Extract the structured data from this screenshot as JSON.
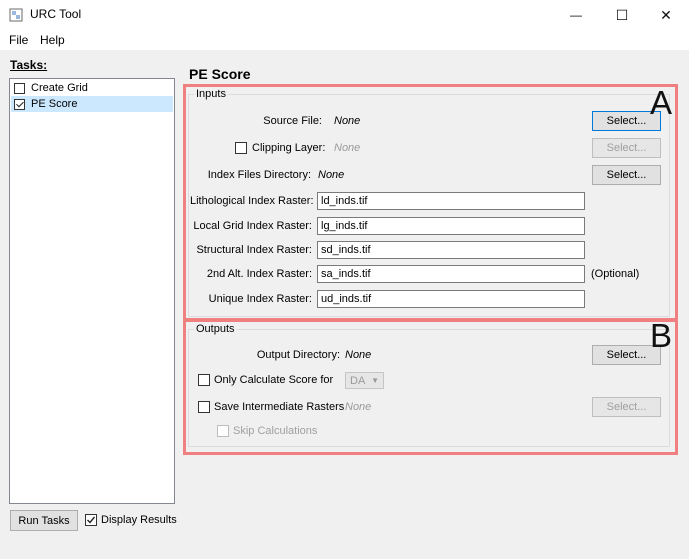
{
  "window": {
    "title": "URC Tool",
    "minimize_glyph": "—",
    "maximize_glyph": "☐",
    "close_glyph": "✕"
  },
  "menu": {
    "file": "File",
    "help": "Help"
  },
  "tasks": {
    "label": "Tasks:",
    "items": [
      {
        "label": "Create Grid",
        "checked": false,
        "selected": false
      },
      {
        "label": "PE Score",
        "checked": true,
        "selected": true
      }
    ],
    "run_button": "Run Tasks",
    "display_results": {
      "label": "Display Results",
      "checked": true
    }
  },
  "pe": {
    "title": "PE Score",
    "inputs": {
      "group_title": "Inputs",
      "source_file": {
        "label": "Source File:",
        "value": "None",
        "button": "Select..."
      },
      "clipping_layer": {
        "label": "Clipping Layer:",
        "value": "None",
        "button": "Select...",
        "checked": false
      },
      "index_dir": {
        "label": "Index Files Directory:",
        "value": "None",
        "button": "Select..."
      },
      "rasters": [
        {
          "label": "Lithological Index Raster:",
          "value": "ld_inds.tif",
          "note": ""
        },
        {
          "label": "Local Grid Index Raster:",
          "value": "lg_inds.tif",
          "note": ""
        },
        {
          "label": "Structural Index Raster:",
          "value": "sd_inds.tif",
          "note": ""
        },
        {
          "label": "2nd Alt. Index Raster:",
          "value": "sa_inds.tif",
          "note": "(Optional)"
        },
        {
          "label": "Unique Index Raster:",
          "value": "ud_inds.tif",
          "note": ""
        }
      ]
    },
    "outputs": {
      "group_title": "Outputs",
      "output_dir": {
        "label": "Output Directory:",
        "value": "None",
        "button": "Select..."
      },
      "only_calc": {
        "label": "Only Calculate Score for",
        "option": "DA",
        "checked": false
      },
      "save_intermediate": {
        "label": "Save Intermediate Rasters",
        "value": "None",
        "button": "Select...",
        "checked": false
      },
      "skip_calc": {
        "label": "Skip Calculations",
        "checked": false
      }
    }
  },
  "annotations": {
    "a_letter": "A",
    "b_letter": "B"
  },
  "colors": {
    "annotation": "#f08080",
    "selection": "#cce8ff",
    "accent": "#0078d7"
  }
}
